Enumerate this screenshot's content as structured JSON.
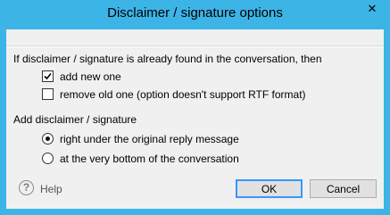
{
  "window": {
    "title": "Disclaimer / signature options",
    "close_glyph": "✕"
  },
  "section1": {
    "heading": "If disclaimer / signature is already found in the conversation, then",
    "options": [
      {
        "label": "add new one",
        "checked": true
      },
      {
        "label": "remove old one (option doesn't support RTF format)",
        "checked": false
      }
    ]
  },
  "section2": {
    "heading": "Add disclaimer / signature",
    "options": [
      {
        "label": "right under the original reply message",
        "selected": true
      },
      {
        "label": "at the very bottom of the conversation",
        "selected": false
      }
    ]
  },
  "footer": {
    "help_glyph": "?",
    "help_label": "Help",
    "ok_label": "OK",
    "cancel_label": "Cancel"
  },
  "colors": {
    "titlebar": "#3cb4e6",
    "client": "#f0f0f0",
    "default_button_border": "#3399ff"
  }
}
